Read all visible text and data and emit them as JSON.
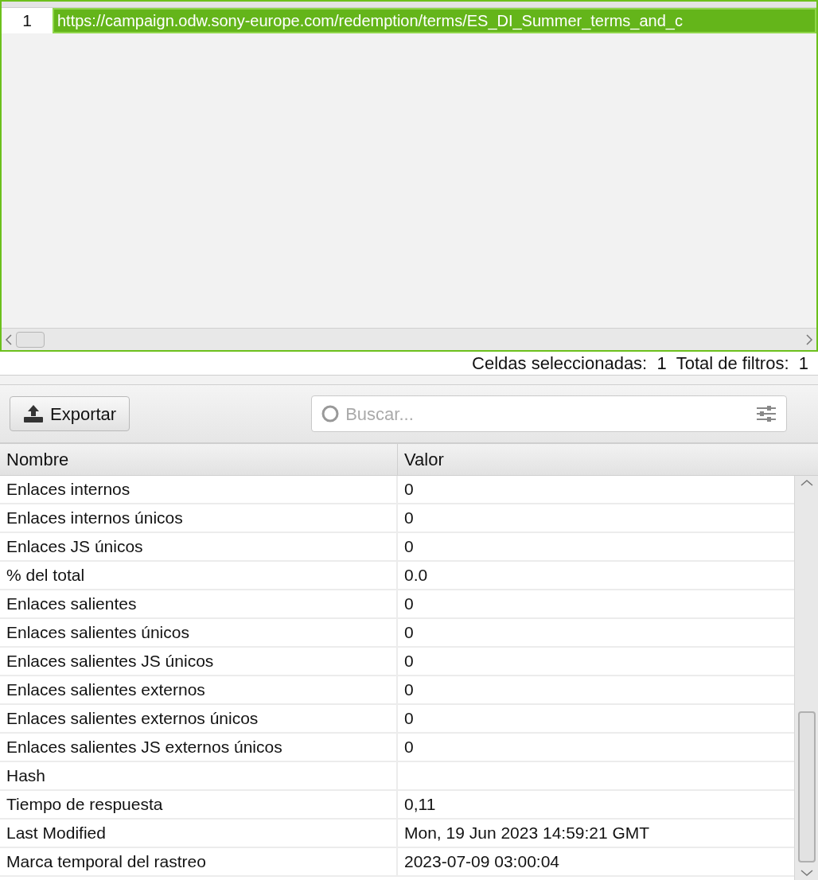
{
  "url_table": {
    "rows": [
      {
        "number": "1",
        "url": "https://campaign.odw.sony-europe.com/redemption/terms/ES_DI_Summer_terms_and_c",
        "selected": true
      }
    ]
  },
  "status_bar": {
    "selected_cells": "Celdas seleccionadas:  1",
    "total_filters": "Total de filtros:  1"
  },
  "toolbar": {
    "export_button": "Exportar",
    "search": {
      "placeholder": "Buscar..."
    }
  },
  "details_table": {
    "columns": [
      "Nombre",
      "Valor"
    ],
    "rows": [
      {
        "name": "Enlaces internos",
        "value": "0"
      },
      {
        "name": "Enlaces internos únicos",
        "value": "0"
      },
      {
        "name": "Enlaces JS únicos",
        "value": "0"
      },
      {
        "name": "% del total",
        "value": "0.0"
      },
      {
        "name": "Enlaces salientes",
        "value": "0"
      },
      {
        "name": "Enlaces salientes únicos",
        "value": "0"
      },
      {
        "name": "Enlaces salientes JS únicos",
        "value": "0"
      },
      {
        "name": "Enlaces salientes externos",
        "value": "0"
      },
      {
        "name": "Enlaces salientes externos únicos",
        "value": "0"
      },
      {
        "name": "Enlaces salientes JS externos únicos",
        "value": "0"
      },
      {
        "name": "Hash",
        "value": ""
      },
      {
        "name": "Tiempo de respuesta",
        "value": "0,11"
      },
      {
        "name": "Last Modified",
        "value": "Mon, 19 Jun 2023 14:59:21 GMT"
      },
      {
        "name": "Marca temporal del rastreo",
        "value": "2023-07-09 03:00:04"
      }
    ]
  }
}
